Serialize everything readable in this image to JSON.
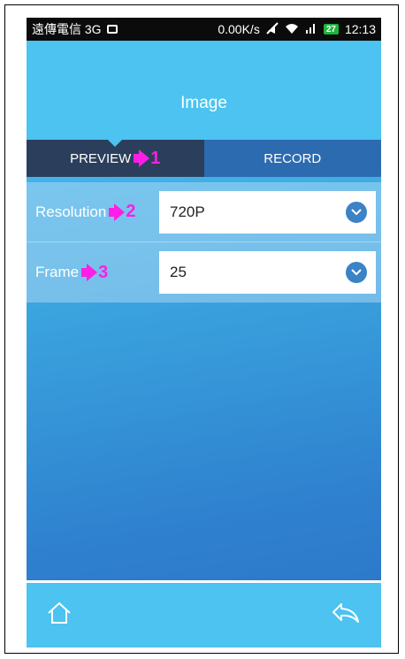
{
  "status_bar": {
    "carrier": "遠傳電信 3G",
    "speed": "0.00K/s",
    "battery": "27",
    "time": "12:13",
    "icons": [
      "image-notification-icon",
      "mute-icon",
      "wifi-icon",
      "signal-icon",
      "battery-icon"
    ]
  },
  "header": {
    "title": "Image"
  },
  "tabs": [
    {
      "label": "PREVIEW",
      "active": true
    },
    {
      "label": "RECORD",
      "active": false
    }
  ],
  "annotations": {
    "a1": "1",
    "a2": "2",
    "a3": "3",
    "color": "#ff1ee6"
  },
  "settings": {
    "resolution": {
      "label": "Resolution",
      "value": "720P"
    },
    "frame": {
      "label": "Frame",
      "value": "25"
    }
  },
  "bottom_bar": {
    "icons": [
      "home-icon",
      "back-icon"
    ]
  },
  "colors": {
    "header": "#4cc3f0",
    "tab_active": "#2b3f5c",
    "tab_inactive": "#2d6bb0",
    "chevron": "#3b82c7"
  }
}
